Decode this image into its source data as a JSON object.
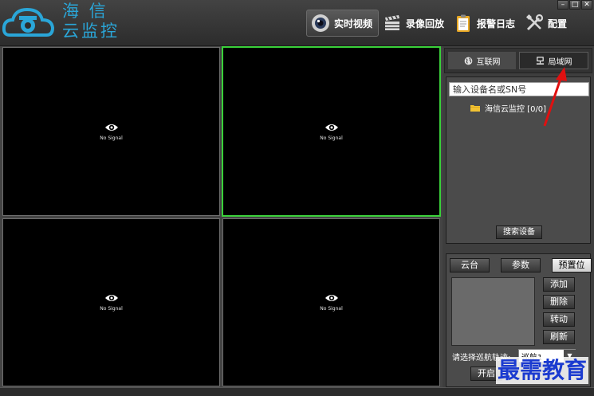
{
  "app": {
    "logo_line1": "海  信",
    "logo_line2": "云监控",
    "accent_color": "#2aa6d8"
  },
  "nav": {
    "items": [
      {
        "label": "实时视频",
        "icon": "camera-lens-icon",
        "active": true
      },
      {
        "label": "录像回放",
        "icon": "clapperboard-icon",
        "active": false
      },
      {
        "label": "报警日志",
        "icon": "clipboard-icon",
        "active": false
      },
      {
        "label": "配置",
        "icon": "tools-icon",
        "active": false
      }
    ]
  },
  "window_controls": [
    "minimize-icon",
    "maximize-icon",
    "close-icon"
  ],
  "video": {
    "no_signal": "No Signal",
    "cells": [
      {
        "selected": false
      },
      {
        "selected": true,
        "border_color": "#3ad13a"
      },
      {
        "selected": false
      },
      {
        "selected": false
      }
    ]
  },
  "device_panel": {
    "tabs": [
      {
        "label": "互联网",
        "icon": "globe-icon",
        "active": false
      },
      {
        "label": "局域网",
        "icon": "lan-icon",
        "active": true
      }
    ],
    "search_value": "输入设备名或SN号",
    "tree": [
      {
        "label": "海信云监控 [0/0]",
        "icon": "folder-icon"
      }
    ],
    "search_button": "搜索设备"
  },
  "ptz_panel": {
    "tabs": [
      {
        "label": "云台",
        "active": false
      },
      {
        "label": "参数",
        "active": false
      },
      {
        "label": "预置位",
        "active": true
      }
    ],
    "buttons": [
      "添加",
      "删除",
      "转动",
      "刷新"
    ],
    "cruise_label": "请选择巡航轨迹:",
    "cruise_value": "巡航1",
    "open_button": "开启"
  },
  "watermark": "最需教育",
  "annotation_color": "#e01010"
}
